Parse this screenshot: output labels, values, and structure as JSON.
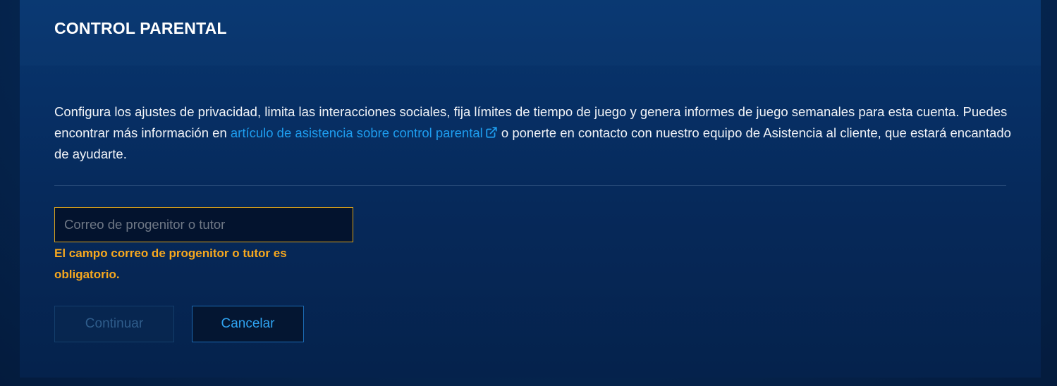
{
  "header": {
    "title": "CONTROL PARENTAL"
  },
  "description": {
    "text_before": "Configura los ajustes de privacidad, limita las interacciones sociales, fija límites de tiempo de juego y genera informes de juego semanales para esta cuenta. Puedes encontrar más información en ",
    "link_text": "artículo de asistencia sobre control parental",
    "link_icon": "external-link-icon",
    "text_after": " o ponerte en contacto con nuestro equipo de Asistencia al cliente, que estará encantado de ayudarte."
  },
  "form": {
    "email_placeholder": "Correo de progenitor o tutor",
    "email_value": "",
    "error_message": "El campo correo de progenitor o tutor es obligatorio."
  },
  "buttons": {
    "continue_label": "Continuar",
    "cancel_label": "Cancelar"
  },
  "colors": {
    "link": "#1e9ef0",
    "error": "#f7a81e",
    "input_border_error": "#d9a21d",
    "cancel_text": "#2fa4f2",
    "continue_disabled_text": "#2f5d8c"
  }
}
